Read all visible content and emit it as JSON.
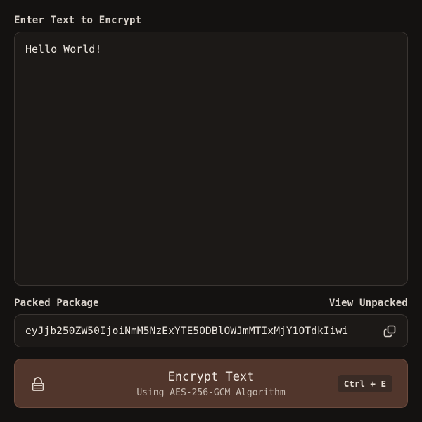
{
  "input": {
    "label": "Enter Text to Encrypt",
    "value": "Hello World!"
  },
  "package": {
    "label": "Packed Package",
    "view_unpacked": "View Unpacked",
    "value": "eyJjb250ZW50IjoiNmM5NzExYTE5ODBlOWJmMTIxMjY1OTdkIiwi",
    "copy_icon": "copy-icon"
  },
  "encrypt_button": {
    "title": "Encrypt Text",
    "subtitle": "Using AES-256-GCM Algorithm",
    "shortcut": "Ctrl + E",
    "icon": "lock-icon"
  },
  "colors": {
    "background": "#141211",
    "panel": "#1c1917",
    "border": "#3a3532",
    "button": "#51362c"
  }
}
